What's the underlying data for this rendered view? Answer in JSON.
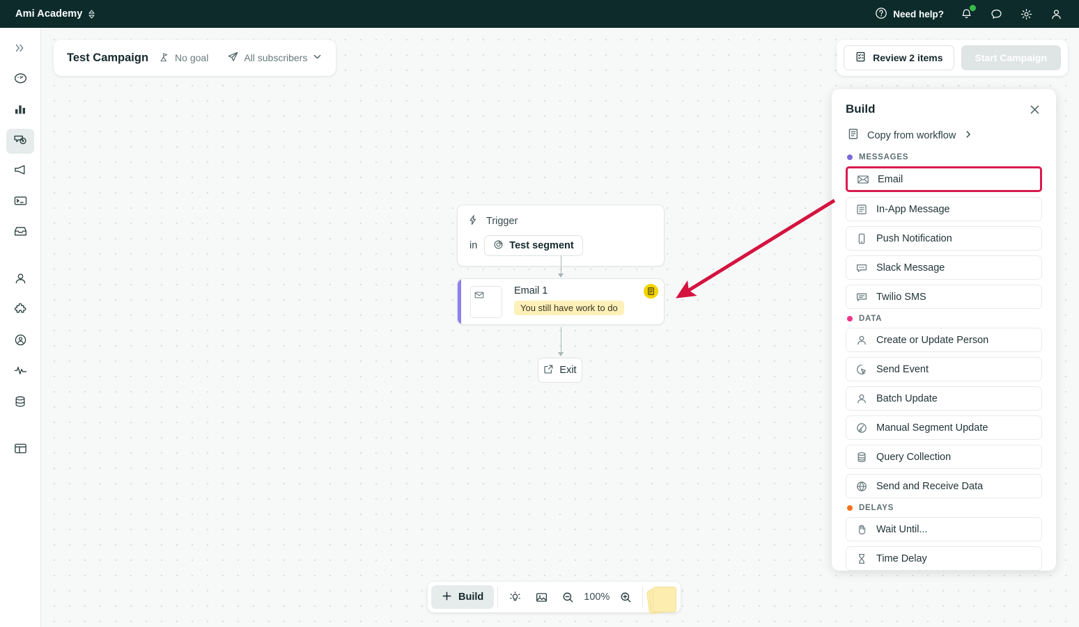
{
  "topbar": {
    "brand": "Ami Academy",
    "need_help": "Need help?",
    "icons": [
      "help-circle-icon",
      "bell-icon",
      "chat-icon",
      "gear-icon",
      "user-icon"
    ],
    "notification_dot_color": "#3aba4a"
  },
  "sidebar": {
    "items": [
      {
        "name": "collapse-expand",
        "icon": "chevrons-right-icon",
        "active": false
      },
      {
        "name": "dashboard",
        "icon": "gauge-icon",
        "active": false
      },
      {
        "name": "analytics",
        "icon": "bar-chart-icon",
        "active": false
      },
      {
        "name": "campaigns",
        "icon": "campaign-eye-icon",
        "active": true
      },
      {
        "name": "broadcasts",
        "icon": "megaphone-icon",
        "active": false
      },
      {
        "name": "transactional",
        "icon": "terminal-icon",
        "active": false
      },
      {
        "name": "inbox",
        "icon": "inbox-icon",
        "active": false
      },
      {
        "name": "people",
        "icon": "person-icon",
        "active": false
      },
      {
        "name": "integrations",
        "icon": "puzzle-icon",
        "active": false
      },
      {
        "name": "audience",
        "icon": "user-circle-icon",
        "active": false
      },
      {
        "name": "activity-logs",
        "icon": "activity-pulse-icon",
        "active": false
      },
      {
        "name": "data-store",
        "icon": "database-icon",
        "active": false
      },
      {
        "name": "collections",
        "icon": "layout-table-icon",
        "active": false
      }
    ]
  },
  "campaign_header": {
    "title": "Test Campaign",
    "goal_icon": "goal-flag-icon",
    "goal_label": "No goal",
    "audience_icon": "paper-plane-icon",
    "audience_label": "All subscribers",
    "chevron_icon": "chevron-down-icon"
  },
  "actions": {
    "review_icon": "checklist-icon",
    "review_label": "Review 2 items",
    "start_label": "Start Campaign",
    "start_disabled": true
  },
  "canvas": {
    "trigger": {
      "icon": "lightning-icon",
      "label": "Trigger",
      "in_label": "in",
      "segment_icon": "segment-circles-icon",
      "segment_label": "Test segment"
    },
    "email_node": {
      "icon": "envelope-icon",
      "title": "Email 1",
      "warning_badge_icon": "document-warning-icon",
      "warning_badge_color": "#f2d400",
      "status_pill": "You still have work to do",
      "accent_color": "#8b80f0"
    },
    "exit_node": {
      "icon": "external-link-icon",
      "label": "Exit"
    }
  },
  "toolbar": {
    "build_icon": "plus-icon",
    "build_label": "Build",
    "tip_icon": "lightbulb-icon",
    "image_icon": "image-icon",
    "zoom_out_icon": "zoom-out-icon",
    "zoom_level": "100%",
    "zoom_in_icon": "zoom-in-icon",
    "sticky_icon": "sticky-notes-icon"
  },
  "build_panel": {
    "title": "Build",
    "close_icon": "close-icon",
    "copy_icon": "clipboard-icon",
    "copy_label": "Copy from workflow",
    "copy_chevron": "chevron-right-icon",
    "sections": [
      {
        "label": "MESSAGES",
        "dot_color": "#7c6ad6",
        "items": [
          {
            "label": "Email",
            "icon": "envelope-icon",
            "highlighted": true
          },
          {
            "label": "In-App Message",
            "icon": "in-app-doc-icon",
            "highlighted": false
          },
          {
            "label": "Push Notification",
            "icon": "mobile-phone-icon",
            "highlighted": false
          },
          {
            "label": "Slack Message",
            "icon": "slack-bubble-icon",
            "highlighted": false
          },
          {
            "label": "Twilio SMS",
            "icon": "sms-bubble-icon",
            "highlighted": false
          }
        ]
      },
      {
        "label": "DATA",
        "dot_color": "#f0338a",
        "items": [
          {
            "label": "Create or Update Person",
            "icon": "person-icon",
            "highlighted": false
          },
          {
            "label": "Send Event",
            "icon": "cursor-click-icon",
            "highlighted": false
          },
          {
            "label": "Batch Update",
            "icon": "person-icon",
            "highlighted": false
          },
          {
            "label": "Manual Segment Update",
            "icon": "segment-wrench-icon",
            "highlighted": false
          },
          {
            "label": "Query Collection",
            "icon": "database-icon",
            "highlighted": false
          },
          {
            "label": "Send and Receive Data",
            "icon": "globe-sync-icon",
            "highlighted": false
          }
        ]
      },
      {
        "label": "DELAYS",
        "dot_color": "#f2711c",
        "items": [
          {
            "label": "Wait Until...",
            "icon": "hand-stop-icon",
            "highlighted": false
          },
          {
            "label": "Time Delay",
            "icon": "hourglass-icon",
            "highlighted": false
          }
        ]
      }
    ]
  },
  "annotation": {
    "arrow_color": "#d4143f",
    "highlight_color": "#da1b4d"
  }
}
